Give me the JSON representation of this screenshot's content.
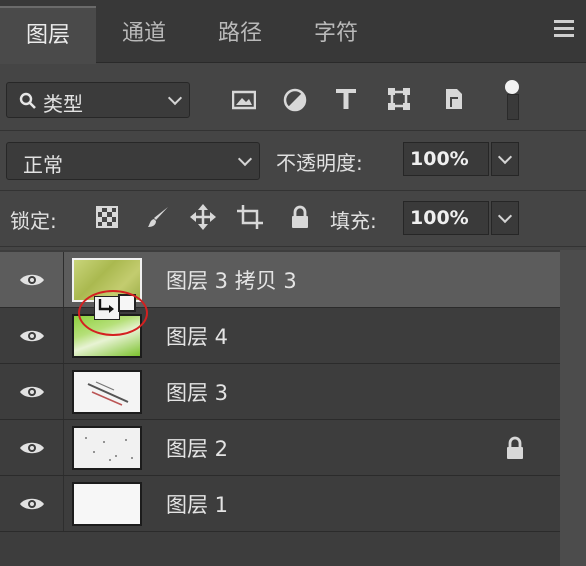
{
  "tabs": [
    {
      "label": "图层",
      "active": true
    },
    {
      "label": "通道",
      "active": false
    },
    {
      "label": "路径",
      "active": false
    },
    {
      "label": "字符",
      "active": false
    }
  ],
  "filter": {
    "kind_label": "类型"
  },
  "blend": {
    "mode": "正常",
    "opacity_label": "不透明度:",
    "opacity_value": "100%"
  },
  "lock": {
    "label": "锁定:",
    "fill_label": "填充:",
    "fill_value": "100%"
  },
  "layers": [
    {
      "name": "图层 3 拷贝 3",
      "selected": true,
      "visible": true,
      "locked": false
    },
    {
      "name": "图层 4",
      "selected": false,
      "visible": true,
      "locked": false
    },
    {
      "name": "图层 3",
      "selected": false,
      "visible": true,
      "locked": false
    },
    {
      "name": "图层 2",
      "selected": false,
      "visible": true,
      "locked": true
    },
    {
      "name": "图层 1",
      "selected": false,
      "visible": true,
      "locked": false
    }
  ],
  "colors": {
    "annotation": "#d42020",
    "selected_row": "#5c5c5c",
    "panel": "#454545"
  }
}
